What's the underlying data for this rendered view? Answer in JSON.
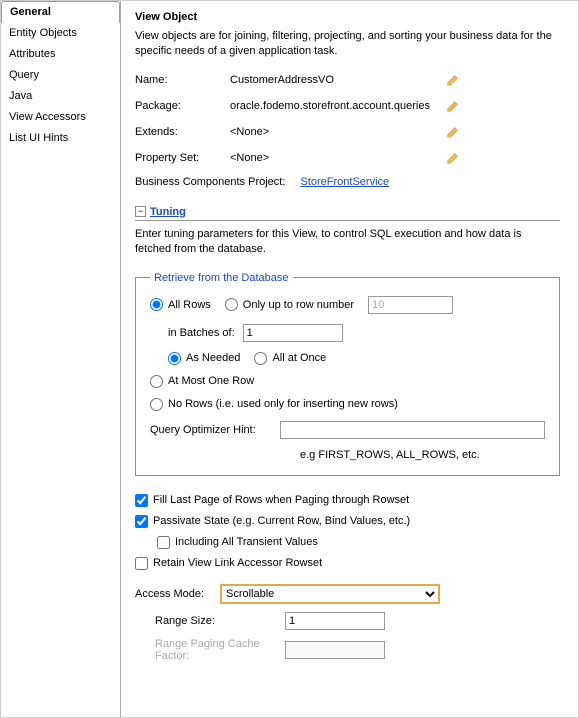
{
  "sidebar": {
    "tabs": [
      {
        "label": "General",
        "active": true
      },
      {
        "label": "Entity Objects"
      },
      {
        "label": "Attributes"
      },
      {
        "label": "Query"
      },
      {
        "label": "Java"
      },
      {
        "label": "View Accessors"
      },
      {
        "label": "List UI Hints"
      }
    ]
  },
  "main": {
    "heading": "View Object",
    "description": "View objects are for joining, filtering, projecting, and sorting your business data for the specific needs of a given application task.",
    "props": {
      "name_label": "Name:",
      "name_value": "CustomerAddressVO",
      "package_label": "Package:",
      "package_value": "oracle.fodemo.storefront.account.queries",
      "extends_label": "Extends:",
      "extends_value": "<None>",
      "propset_label": "Property Set:",
      "propset_value": "<None>",
      "bcp_label": "Business Components Project:",
      "bcp_link": "StoreFrontService"
    },
    "tuning": {
      "expander": "−",
      "title": "Tuning",
      "description": "Enter tuning parameters for this View, to control SQL execution and how data is fetched from the database.",
      "fieldset_legend": "Retrieve from the Database",
      "all_rows": "All Rows",
      "only_up_to": "Only up to row number",
      "only_up_to_value": "10",
      "in_batches": "in Batches of:",
      "in_batches_value": "1",
      "as_needed": "As Needed",
      "all_at_once": "All at Once",
      "at_most_one": "At Most One Row",
      "no_rows": "No Rows (i.e. used only for inserting new rows)",
      "qoh_label": "Query Optimizer Hint:",
      "qoh_value": "",
      "qoh_hint": "e.g FIRST_ROWS, ALL_ROWS, etc.",
      "fill_last": "Fill Last Page of Rows when Paging through Rowset",
      "passivate": "Passivate State (e.g. Current Row, Bind Values, etc.)",
      "including_trans": "Including All Transient Values",
      "retain_vla": "Retain View Link Accessor Rowset",
      "access_mode_label": "Access Mode:",
      "access_mode_value": "Scrollable",
      "range_size_label": "Range Size:",
      "range_size_value": "1",
      "range_cache_label": "Range Paging Cache Factor:",
      "range_cache_value": ""
    }
  }
}
